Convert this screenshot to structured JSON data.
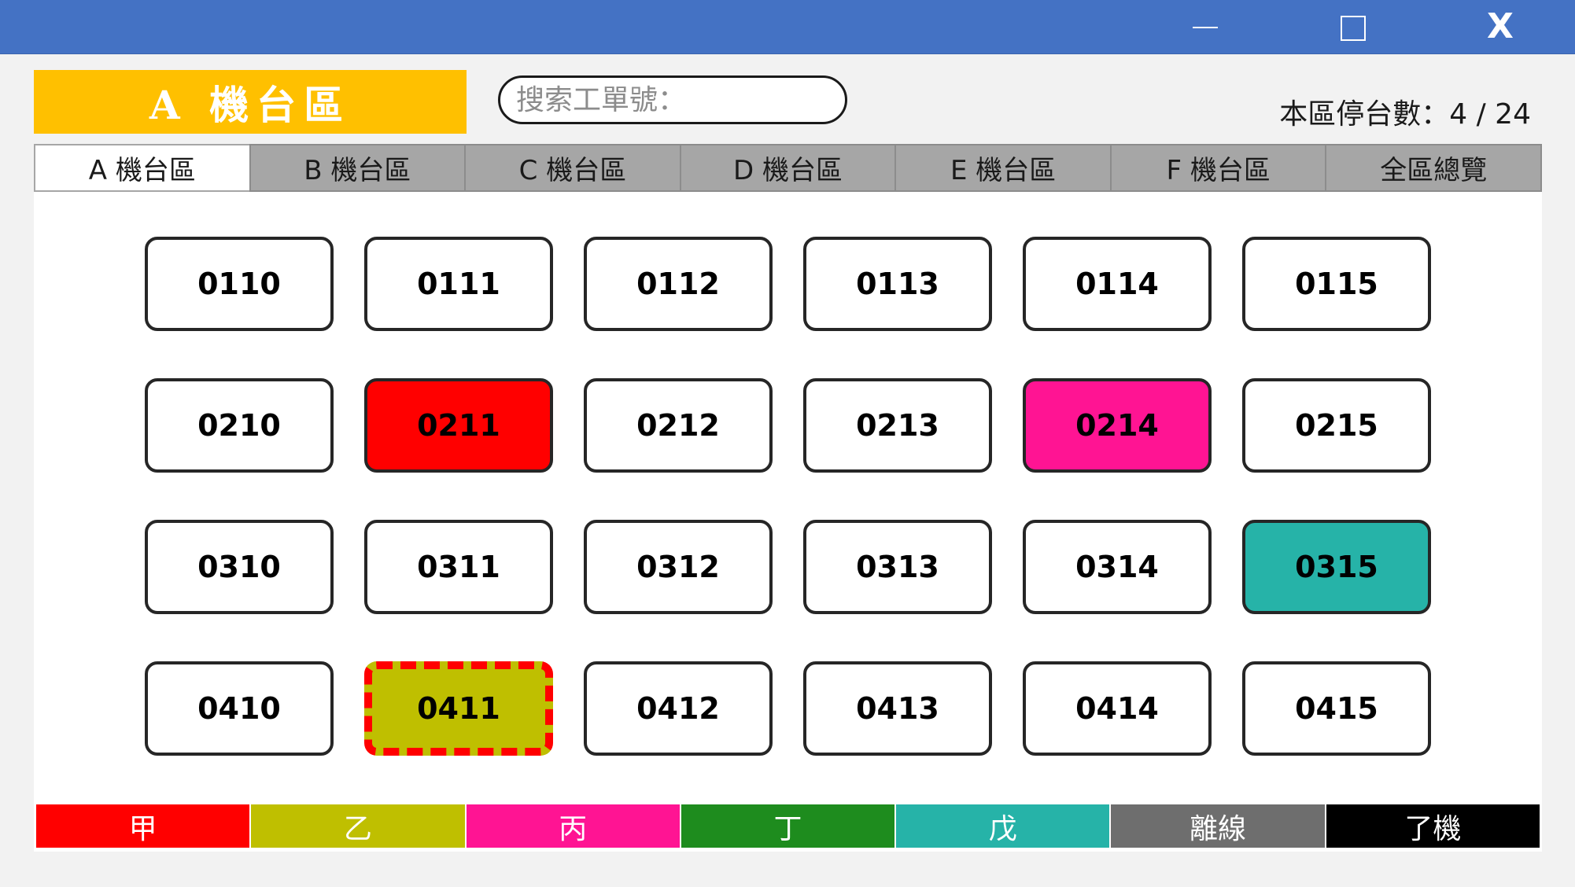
{
  "window": {
    "minimize_icon": "minimize-icon",
    "maximize_icon": "maximize-icon",
    "close_label": "X"
  },
  "header": {
    "title": "A 機台區",
    "title_bg": "#ffc000",
    "search_placeholder": "搜索工單號：",
    "stop_count": "本區停台數：4 / 24"
  },
  "tabs": [
    {
      "label": "A 機台區"
    },
    {
      "label": "B 機台區"
    },
    {
      "label": "C 機台區"
    },
    {
      "label": "D 機台區"
    },
    {
      "label": "E 機台區"
    },
    {
      "label": "F 機台區"
    },
    {
      "label": "全區總覽"
    }
  ],
  "machines": [
    {
      "id": "0110",
      "color": "#ffffff"
    },
    {
      "id": "0111",
      "color": "#ffffff"
    },
    {
      "id": "0112",
      "color": "#ffffff"
    },
    {
      "id": "0113",
      "color": "#ffffff"
    },
    {
      "id": "0114",
      "color": "#ffffff"
    },
    {
      "id": "0115",
      "color": "#ffffff"
    },
    {
      "id": "0210",
      "color": "#ffffff"
    },
    {
      "id": "0211",
      "color": "#ff0000"
    },
    {
      "id": "0212",
      "color": "#ffffff"
    },
    {
      "id": "0213",
      "color": "#ffffff"
    },
    {
      "id": "0214",
      "color": "#ff1493"
    },
    {
      "id": "0215",
      "color": "#ffffff"
    },
    {
      "id": "0310",
      "color": "#ffffff"
    },
    {
      "id": "0311",
      "color": "#ffffff"
    },
    {
      "id": "0312",
      "color": "#ffffff"
    },
    {
      "id": "0313",
      "color": "#ffffff"
    },
    {
      "id": "0314",
      "color": "#ffffff"
    },
    {
      "id": "0315",
      "color": "#26b3a8"
    },
    {
      "id": "0410",
      "color": "#ffffff"
    },
    {
      "id": "0411",
      "color": "#bfbf00",
      "dashed": true
    },
    {
      "id": "0412",
      "color": "#ffffff"
    },
    {
      "id": "0413",
      "color": "#ffffff"
    },
    {
      "id": "0414",
      "color": "#ffffff"
    },
    {
      "id": "0415",
      "color": "#ffffff"
    }
  ],
  "legend": [
    {
      "label": "甲",
      "color": "#ff0000"
    },
    {
      "label": "乙",
      "color": "#bfbf00"
    },
    {
      "label": "丙",
      "color": "#ff1493"
    },
    {
      "label": "丁",
      "color": "#1e8c1e"
    },
    {
      "label": "戊",
      "color": "#26b3a8"
    },
    {
      "label": "離線",
      "color": "#6e6e6e"
    },
    {
      "label": "了機",
      "color": "#000000"
    }
  ]
}
